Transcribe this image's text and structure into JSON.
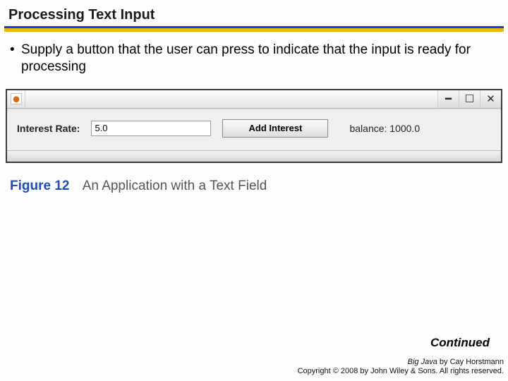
{
  "slide": {
    "heading": "Processing Text Input",
    "bullet": "Supply a button that the user can press to indicate that the input is ready for processing",
    "continued": "Continued"
  },
  "app": {
    "interest_label": "Interest Rate:",
    "interest_value": "5.0",
    "button_label": "Add Interest",
    "balance_text": "balance: 1000.0",
    "icons": {
      "minimize": "━",
      "maximize": "☐",
      "close": "✕"
    }
  },
  "figure": {
    "label": "Figure 12",
    "caption": "An Application with a Text Field"
  },
  "footer": {
    "line1_pre": "Big Java",
    "line1_post": " by Cay Horstmann",
    "line2": "Copyright © 2008 by John Wiley & Sons.  All rights reserved."
  }
}
